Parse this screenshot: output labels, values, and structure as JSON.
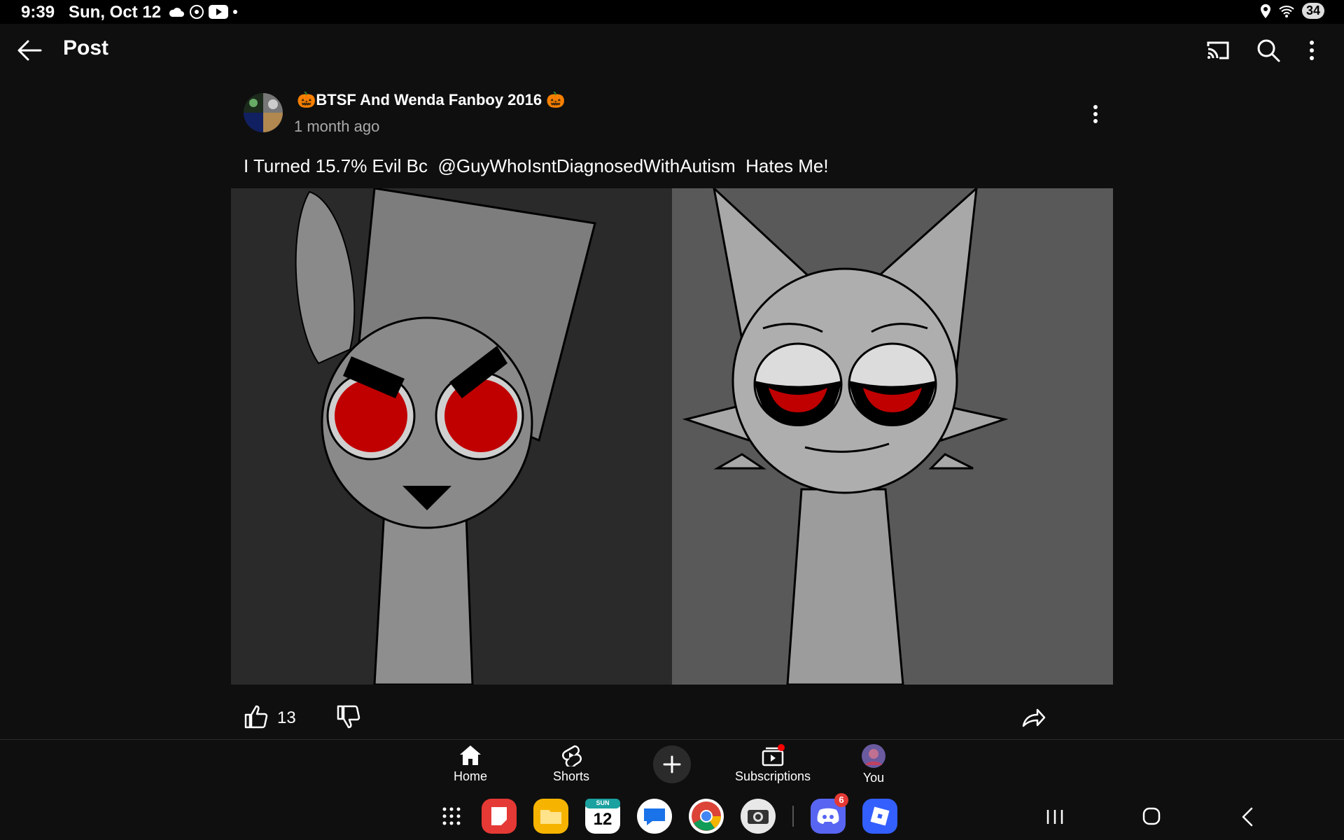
{
  "status_bar": {
    "time": "9:39",
    "date": "Sun, Oct 12",
    "battery": "34"
  },
  "header": {
    "title": "Post"
  },
  "post": {
    "author": "🎃BTSF And Wenda Fanboy 2016 🎃",
    "time": "1 month ago",
    "text": "I Turned 15.7% Evil Bc  @GuyWhoIsntDiagnosedWithAutism  Hates Me!",
    "likes": "13"
  },
  "bottom_nav": {
    "items": [
      {
        "label": "Home",
        "icon": "home-icon"
      },
      {
        "label": "Shorts",
        "icon": "shorts-icon"
      },
      {
        "label": "Subscriptions",
        "icon": "subscriptions-icon"
      },
      {
        "label": "You",
        "icon": "avatar"
      }
    ]
  },
  "dock": {
    "calendar_day": "12",
    "calendar_weekday": "SUN",
    "discord_badge": "6"
  },
  "colors": {
    "background": "#0f0f0f",
    "accent_red": "#c00000",
    "muted_text": "#aaaaaa"
  }
}
